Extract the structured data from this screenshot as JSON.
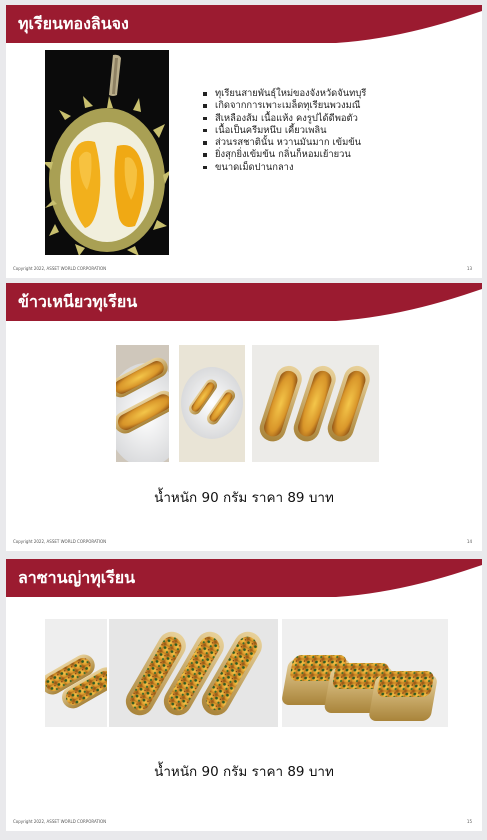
{
  "colors": {
    "accent": "#9b1b30",
    "durian_flesh": "#f2b01c",
    "tray_gold": "#c9a24c",
    "cheese": "#e3b33a"
  },
  "slides": [
    {
      "title": "ทุเรียนทองลินจง",
      "bullets": [
        "ทุเรียนสายพันธุ์ใหม่ของจังหวัดจันทบุรี",
        "เกิดจากการเพาะเมล็ดทุเรียนพวงมณี",
        "สีเหลืองส้ม เนื้อแห้ง คงรูปได้ดีพอตัว",
        "เนื้อเป็นครีมหนึบ เคี้ยวเพลิน",
        "ส่วนรสชาตินั้น หวานมันมาก เข้มข้น",
        "ยิ่งสุกยิ่งเข้มข้น กลิ่นก็หอมเย้ายวน",
        "ขนาดเม็ดปานกลาง"
      ],
      "copyright": "Copyright 2022, ASSET WORLD CORPORATION",
      "page": "13"
    },
    {
      "title": "ข้าวเหนียวทุเรียน",
      "price_text": "น้ำหนัก 90 กรัม ราคา 89 บาท",
      "copyright": "Copyright 2022, ASSET WORLD CORPORATION",
      "page": "14"
    },
    {
      "title": "ลาซานญ่าทุเรียน",
      "price_text": "น้ำหนัก 90 กรัม ราคา 89 บาท",
      "copyright": "Copyright 2022, ASSET WORLD CORPORATION",
      "page": "15"
    }
  ]
}
